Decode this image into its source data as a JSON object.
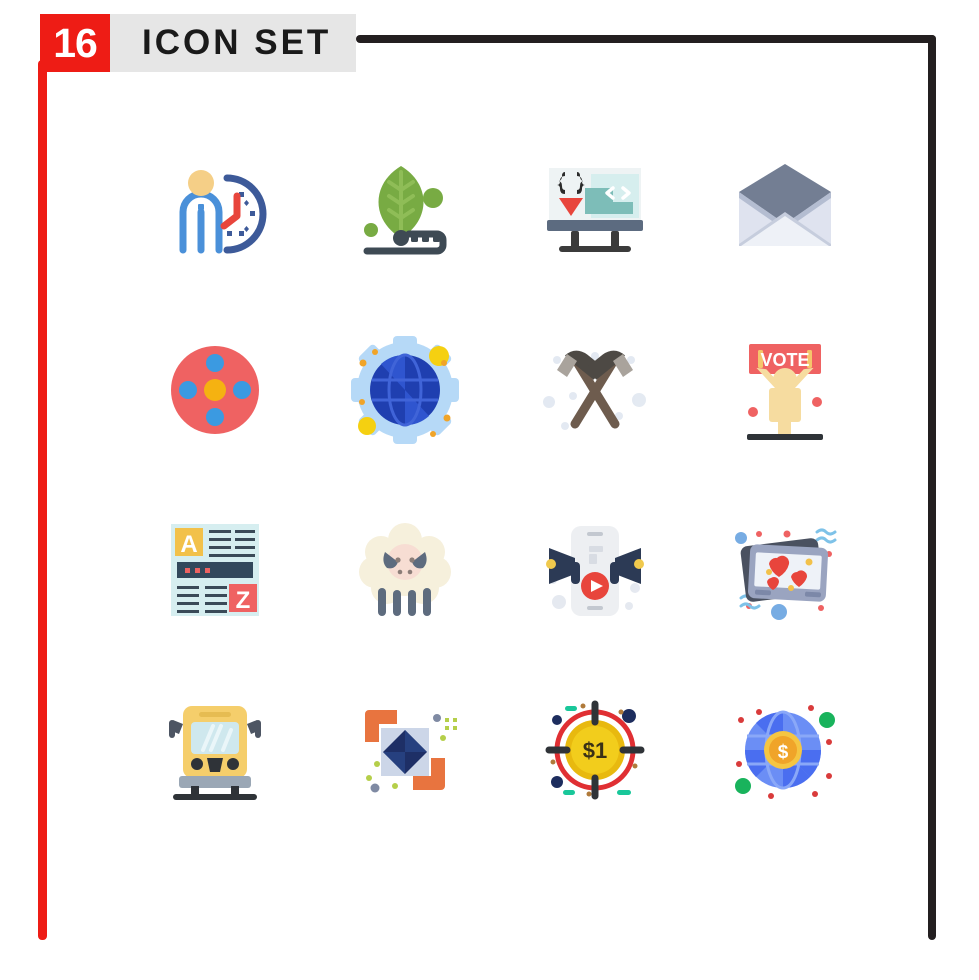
{
  "header": {
    "count": "16",
    "title": "ICON SET"
  },
  "colors": {
    "accent_red": "#ee1c15",
    "frame_black": "#231f20",
    "band_gray": "#e6e6e6",
    "background": "#ffffff"
  },
  "grid": {
    "columns": 4,
    "rows": 4,
    "icons": [
      {
        "index": 1,
        "name": "person-with-clock-icon",
        "label": "Time Management"
      },
      {
        "index": 2,
        "name": "leaf-circuit-icon",
        "label": "Green Technology"
      },
      {
        "index": 3,
        "name": "monitor-code-icon",
        "label": "Web Development"
      },
      {
        "index": 4,
        "name": "open-envelope-icon",
        "label": "Open Mail"
      },
      {
        "index": 5,
        "name": "molecule-circle-icon",
        "label": "Molecule"
      },
      {
        "index": 6,
        "name": "globe-gear-icon",
        "label": "Global Settings"
      },
      {
        "index": 7,
        "name": "crossed-hammers-icon",
        "label": "Crossed Hammers"
      },
      {
        "index": 8,
        "name": "vote-banner-person-icon",
        "label": "Vote Campaign"
      },
      {
        "index": 9,
        "name": "dictionary-a-z-icon",
        "label": "Dictionary"
      },
      {
        "index": 10,
        "name": "sheep-icon",
        "label": "Sheep"
      },
      {
        "index": 11,
        "name": "mobile-megaphone-video-icon",
        "label": "Viral Marketing"
      },
      {
        "index": 12,
        "name": "photo-hearts-icon",
        "label": "Favorite Photos"
      },
      {
        "index": 13,
        "name": "school-bus-icon",
        "label": "School Bus"
      },
      {
        "index": 14,
        "name": "diamond-focus-frame-icon",
        "label": "Diamond Focus"
      },
      {
        "index": 15,
        "name": "dollar-coin-target-icon",
        "label": "Dollar Target"
      },
      {
        "index": 16,
        "name": "globe-dollar-coin-icon",
        "label": "Global Finance"
      }
    ],
    "icon_labels": {
      "vote_banner_text": "VOTE",
      "coin_target_text": "$1",
      "dictionary_letter_a": "A",
      "dictionary_letter_z": "Z"
    }
  }
}
